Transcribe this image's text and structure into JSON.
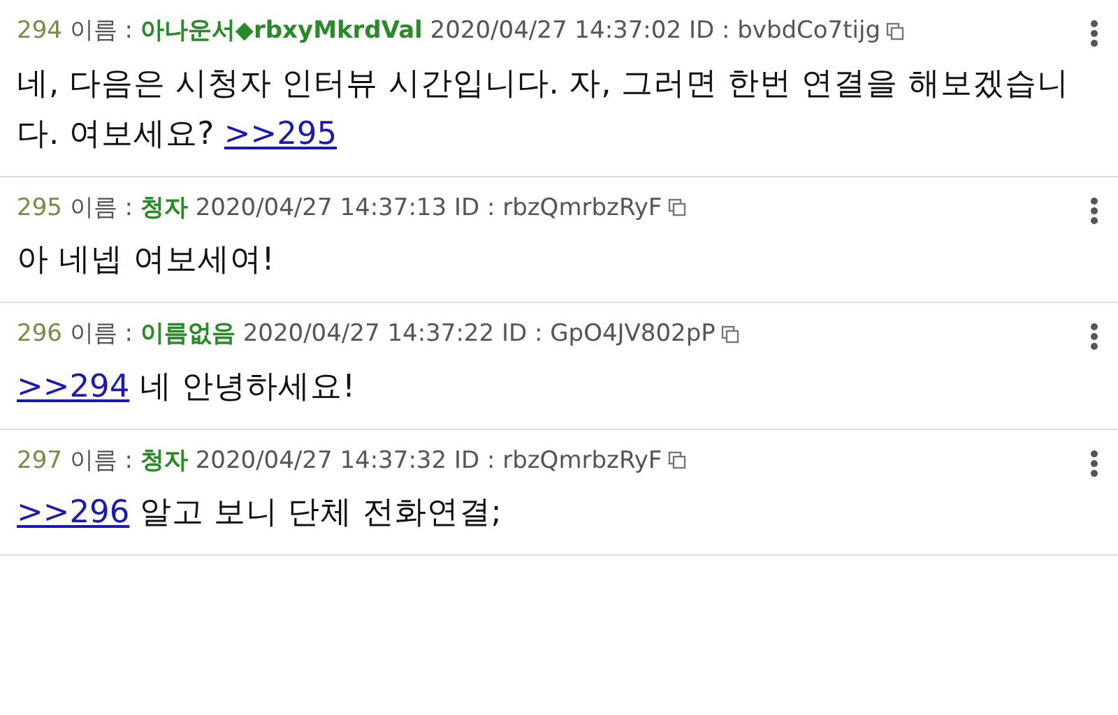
{
  "posts": [
    {
      "number": "294",
      "name_label": "이름 :",
      "name": "아나운서◆rbxyMkrdVal",
      "datetime": "2020/04/27 14:37:02",
      "id_text": "ID : bvbdCo7tijg",
      "body": [
        {
          "kind": "text",
          "text": "네, 다음은 시청자 인터뷰 시간입니다. 자, 그러면 한번 연결을 해보겠습니다. 여보세요? "
        },
        {
          "kind": "link",
          "text": ">>295"
        }
      ]
    },
    {
      "number": "295",
      "name_label": "이름 :",
      "name": "청자",
      "datetime": "2020/04/27 14:37:13",
      "id_text": "ID : rbzQmrbzRyF",
      "body": [
        {
          "kind": "text",
          "text": "아 네넵 여보세여!"
        }
      ]
    },
    {
      "number": "296",
      "name_label": "이름 :",
      "name": "이름없음",
      "datetime": "2020/04/27 14:37:22",
      "id_text": "ID : GpO4JV802pP",
      "body": [
        {
          "kind": "link",
          "text": ">>294"
        },
        {
          "kind": "text",
          "text": " 네 안녕하세요!"
        }
      ]
    },
    {
      "number": "297",
      "name_label": "이름 :",
      "name": "청자",
      "datetime": "2020/04/27 14:37:32",
      "id_text": "ID : rbzQmrbzRyF",
      "body": [
        {
          "kind": "link",
          "text": ">>296"
        },
        {
          "kind": "text",
          "text": " 알고 보니 단체 전화연결;"
        }
      ]
    }
  ]
}
